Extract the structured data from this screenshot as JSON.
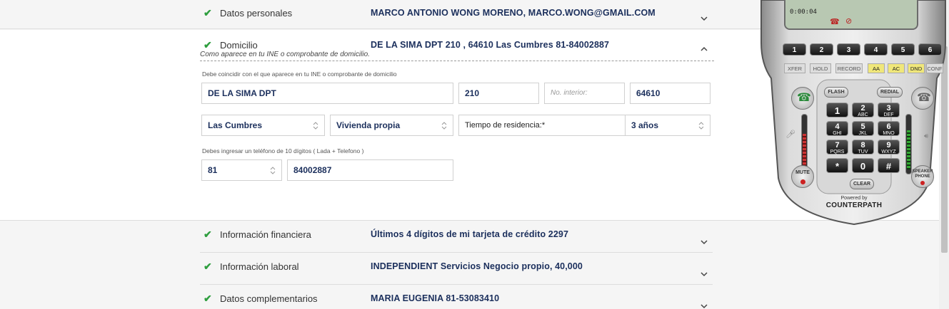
{
  "sections": [
    {
      "title": "Datos personales",
      "value": "MARCO ANTONIO WONG MORENO, MARCO.WONG@GMAIL.COM",
      "expanded": false
    },
    {
      "title": "Domicilio",
      "value": "DE LA SIMA DPT 210 , 64610 Las Cumbres 81-84002887",
      "expanded": true
    },
    {
      "title": "Información financiera",
      "value": "Últimos 4 dígitos de mi tarjeta de crédito 2297",
      "expanded": false
    },
    {
      "title": "Información laboral",
      "value": "INDEPENDIENT Servicios Negocio propio, 40,000",
      "expanded": false
    },
    {
      "title": "Datos complementarios",
      "value": "MARIA EUGENIA 81-53083410",
      "expanded": false
    }
  ],
  "domicilio": {
    "hint": "Como aparece en tu INE o comprobante de domicilio.",
    "address_note": "Debe coincidir con el que aparece en tu INE o comprobante de domicilio",
    "street": "DE LA SIMA DPT",
    "ext_number": "210",
    "int_number_placeholder": "No. interior:",
    "zip": "64610",
    "colonia": "Las Cumbres",
    "housing_type": "Vivienda propia",
    "residence_label": "Tiempo de residencia:*",
    "residence_value": "3 años",
    "phone_note": "Debes ingresar un teléfono de 10 dígitos ( Lada + Telefono )",
    "lada": "81",
    "phone": "84002887"
  },
  "softphone": {
    "timer": "0:00:04",
    "lines": [
      "1",
      "2",
      "3",
      "4",
      "5",
      "6"
    ],
    "functions": [
      "XFER",
      "HOLD",
      "RECORD",
      "AA",
      "AC",
      "DND",
      "CONF"
    ],
    "flash": "FLASH",
    "redial": "REDIAL",
    "keys": [
      {
        "d": "1",
        "l": ""
      },
      {
        "d": "2",
        "l": "ABC"
      },
      {
        "d": "3",
        "l": "DEF"
      },
      {
        "d": "4",
        "l": "GHI"
      },
      {
        "d": "5",
        "l": "JKL"
      },
      {
        "d": "6",
        "l": "MNO"
      },
      {
        "d": "7",
        "l": "PQRS"
      },
      {
        "d": "8",
        "l": "TUV"
      },
      {
        "d": "9",
        "l": "WXYZ"
      },
      {
        "d": "*",
        "l": ""
      },
      {
        "d": "0",
        "l": ""
      },
      {
        "d": "#",
        "l": ""
      }
    ],
    "clear": "CLEAR",
    "mute": "MUTE",
    "speaker_line1": "SPEAKER",
    "speaker_line2": "PHONE",
    "powered_by": "Powered by",
    "brand": "COUNTERPATH",
    "colors": {
      "body": "#c9c9c9",
      "screen": "#b8c8b2",
      "lit": "#f0e77a"
    }
  }
}
